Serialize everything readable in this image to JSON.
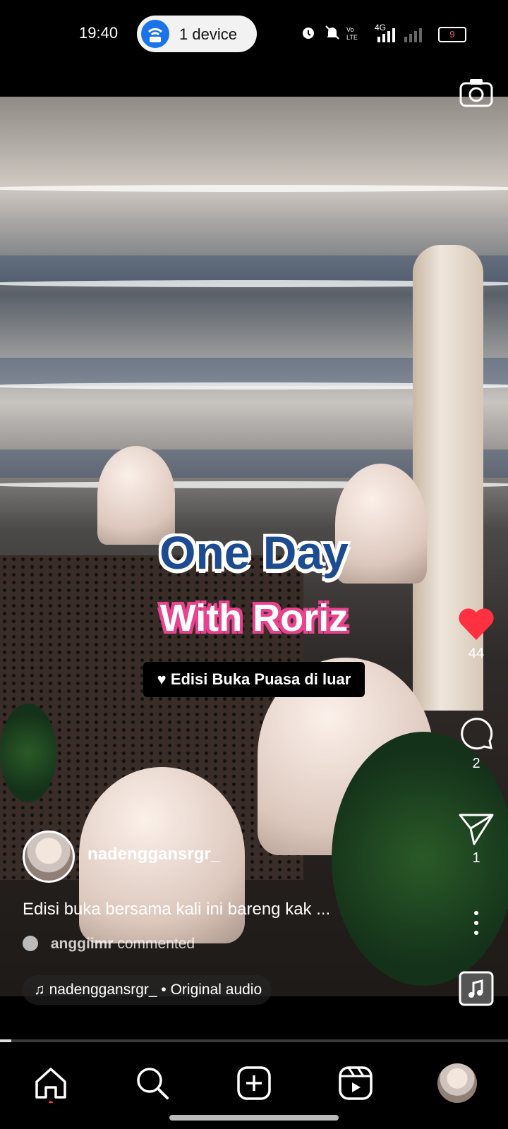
{
  "status_bar": {
    "time": "19:40",
    "connection_pill": "1 device",
    "battery": "9",
    "network": "4G",
    "icons": [
      "wifi-hotspot-icon",
      "alarm-icon",
      "mute-icon",
      "volte-icon",
      "signal-icon",
      "battery-icon"
    ]
  },
  "video": {
    "overlay_title_1": "One Day",
    "overlay_title_2": "With Roriz",
    "overlay_subtitle": "Edisi Buka Puasa di luar",
    "colors": {
      "title_blue": "#1d4b92",
      "title_pink": "#e9428f",
      "like_red": "#ff3040"
    }
  },
  "actions": {
    "likes": "44",
    "comments": "2",
    "shares": "1"
  },
  "post": {
    "username": "nadenggansrgr_",
    "caption": "Edisi buka bersama kali ini bareng kak ...",
    "commenter": "anggiimr",
    "commented_text": "commented",
    "audio": "nadenggansrgr_ • Original audio"
  },
  "nav": {
    "items": [
      "home-icon",
      "search-icon",
      "create-icon",
      "reels-icon",
      "profile-avatar"
    ]
  }
}
